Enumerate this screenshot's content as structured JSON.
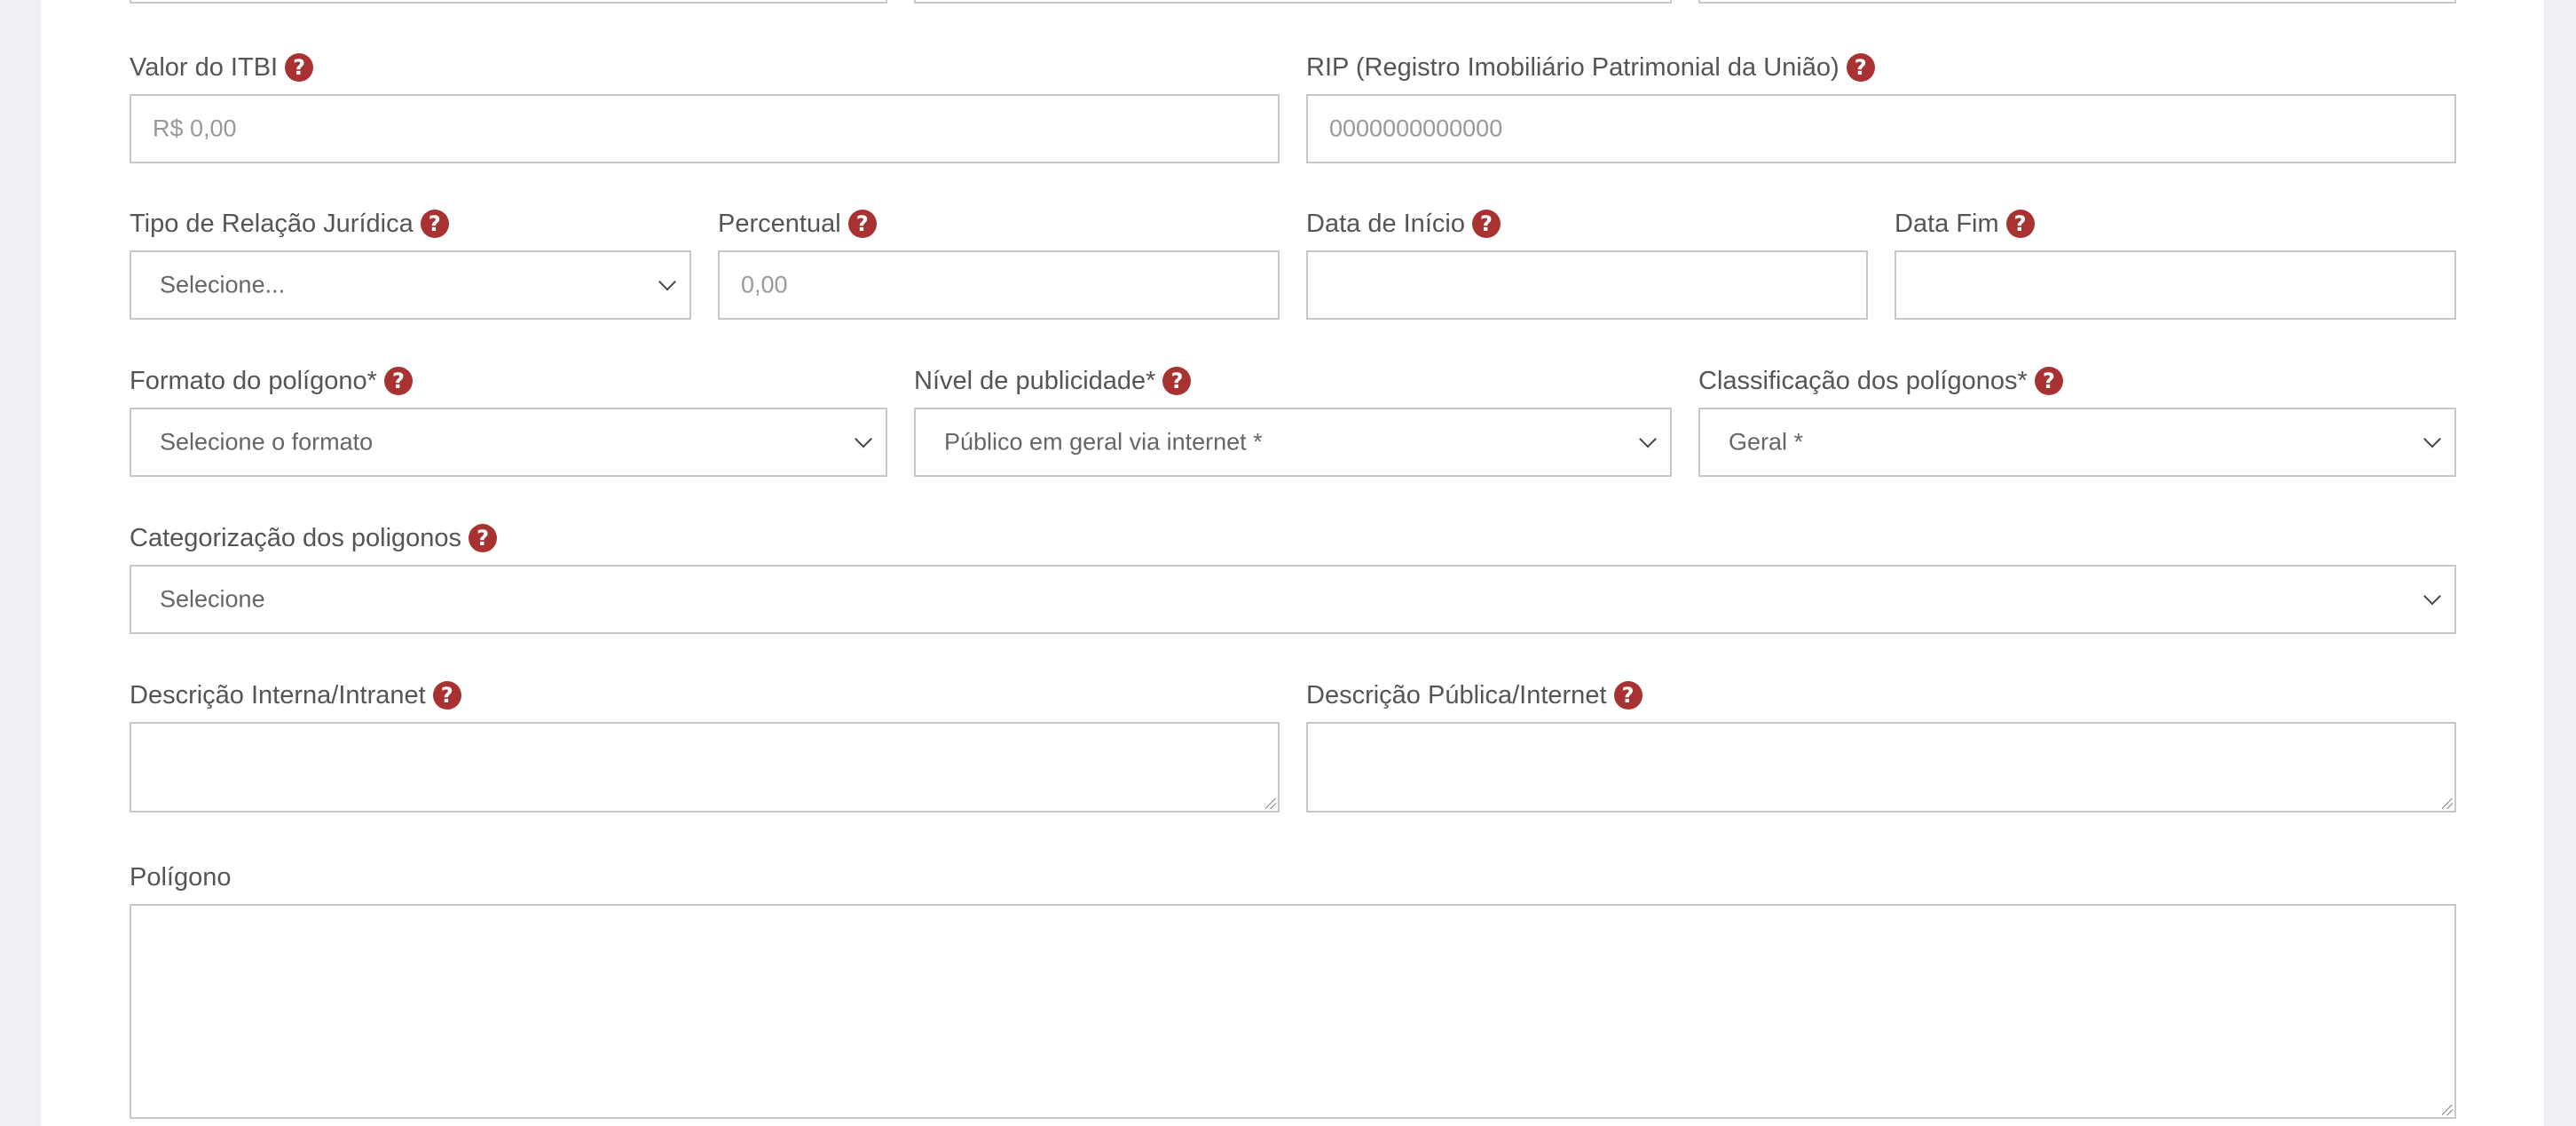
{
  "fields": {
    "valor_itbi": {
      "label": "Valor do ITBI",
      "placeholder": "R$ 0,00"
    },
    "rip": {
      "label": "RIP (Registro Imobiliário Patrimonial da União)",
      "placeholder": "0000000000000"
    },
    "tipo_relacao": {
      "label": "Tipo de Relação Jurídica",
      "value": "Selecione..."
    },
    "percentual": {
      "label": "Percentual",
      "placeholder": "0,00"
    },
    "data_inicio": {
      "label": "Data de Início",
      "value": ""
    },
    "data_fim": {
      "label": "Data Fim",
      "value": ""
    },
    "formato_poligono": {
      "label": "Formato do polígono*",
      "value": "Selecione o formato"
    },
    "nivel_publicidade": {
      "label": "Nível de publicidade*",
      "value": "Público em geral via internet *"
    },
    "classificacao": {
      "label": "Classificação dos polígonos*",
      "value": "Geral *"
    },
    "categorizacao": {
      "label": "Categorização dos poligonos",
      "value": "Selecione"
    },
    "descricao_interna": {
      "label": "Descrição Interna/Intranet",
      "value": ""
    },
    "descricao_publica": {
      "label": "Descrição Pública/Internet",
      "value": ""
    },
    "poligono": {
      "label": "Polígono",
      "value": ""
    }
  },
  "help_glyph": "?",
  "icons": {
    "help": "question-circle-icon",
    "dropdown": "chevron-down-icon"
  },
  "colors": {
    "help_icon": "#a83232",
    "border": "#c8c8c8",
    "background": "#eef0f4"
  }
}
